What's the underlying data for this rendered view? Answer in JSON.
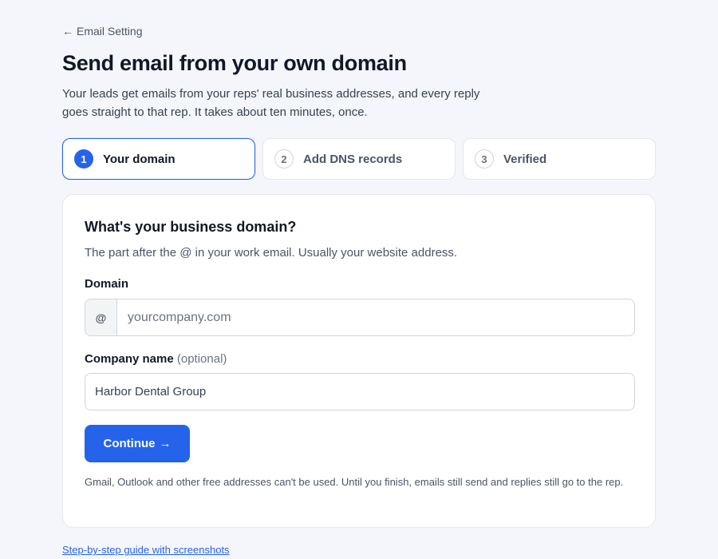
{
  "nav": {
    "back_label": "Email Setting"
  },
  "header": {
    "title": "Send email from your own domain",
    "subtitle": "Your leads get emails from your reps' real business addresses, and every reply goes straight to that rep. It takes about ten minutes, once."
  },
  "steps": [
    {
      "number": "1",
      "label": "Your domain",
      "active": true
    },
    {
      "number": "2",
      "label": "Add DNS records",
      "active": false
    },
    {
      "number": "3",
      "label": "Verified",
      "active": false
    }
  ],
  "form": {
    "title": "What's your business domain?",
    "description": "The part after the @ in your work email. Usually your website address.",
    "domain": {
      "label": "Domain",
      "prefix": "@",
      "placeholder": "yourcompany.com",
      "value": ""
    },
    "company": {
      "label": "Company name",
      "optional_label": "(optional)",
      "value": "Harbor Dental Group"
    },
    "continue_label": "Continue",
    "continue_arrow": "→",
    "note": "Gmail, Outlook and other free addresses can't be used. Until you finish, emails still send and replies still go to the rep."
  },
  "footer": {
    "guide_link": "Step-by-step guide with screenshots"
  },
  "colors": {
    "accent": "#2563eb",
    "background": "#f5f6fb"
  },
  "icons": {
    "back": "arrow-left-icon",
    "continue": "arrow-right-icon"
  }
}
